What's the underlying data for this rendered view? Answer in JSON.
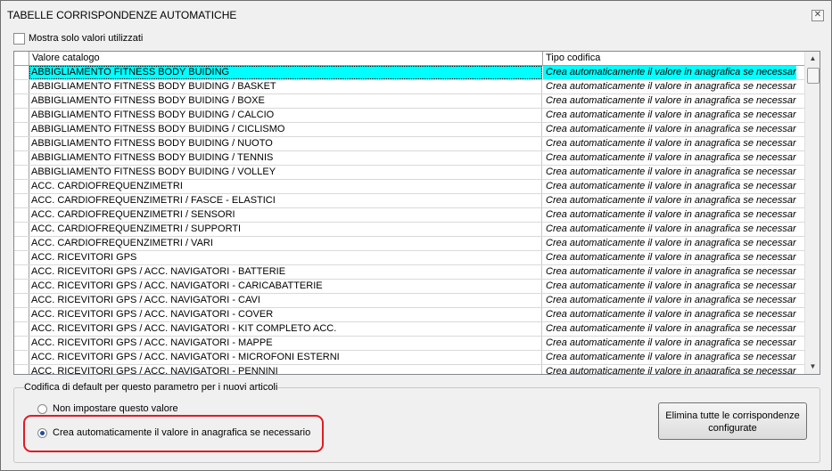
{
  "window": {
    "title": "TABELLE CORRISPONDENZE AUTOMATICHE",
    "close_glyph": "✕"
  },
  "filter": {
    "show_used_only_label": "Mostra solo valori utilizzati",
    "checked": false
  },
  "grid": {
    "columns": [
      "Valore catalogo",
      "Tipo codifica"
    ],
    "rows": [
      {
        "valore": "ABBIGLIAMENTO FITNESS BODY BUIDING",
        "tipo": "Crea automaticamente il valore in anagrafica se necessario"
      },
      {
        "valore": "ABBIGLIAMENTO FITNESS BODY BUIDING / BASKET",
        "tipo": "Crea automaticamente il valore in anagrafica se necessario"
      },
      {
        "valore": "ABBIGLIAMENTO FITNESS BODY BUIDING / BOXE",
        "tipo": "Crea automaticamente il valore in anagrafica se necessario"
      },
      {
        "valore": "ABBIGLIAMENTO FITNESS BODY BUIDING / CALCIO",
        "tipo": "Crea automaticamente il valore in anagrafica se necessario"
      },
      {
        "valore": "ABBIGLIAMENTO FITNESS BODY BUIDING / CICLISMO",
        "tipo": "Crea automaticamente il valore in anagrafica se necessario"
      },
      {
        "valore": "ABBIGLIAMENTO FITNESS BODY BUIDING / NUOTO",
        "tipo": "Crea automaticamente il valore in anagrafica se necessario"
      },
      {
        "valore": "ABBIGLIAMENTO FITNESS BODY BUIDING / TENNIS",
        "tipo": "Crea automaticamente il valore in anagrafica se necessario"
      },
      {
        "valore": "ABBIGLIAMENTO FITNESS BODY BUIDING / VOLLEY",
        "tipo": "Crea automaticamente il valore in anagrafica se necessario"
      },
      {
        "valore": "ACC. CARDIOFREQUENZIMETRI",
        "tipo": "Crea automaticamente il valore in anagrafica se necessario"
      },
      {
        "valore": "ACC. CARDIOFREQUENZIMETRI / FASCE - ELASTICI",
        "tipo": "Crea automaticamente il valore in anagrafica se necessario"
      },
      {
        "valore": "ACC. CARDIOFREQUENZIMETRI / SENSORI",
        "tipo": "Crea automaticamente il valore in anagrafica se necessario"
      },
      {
        "valore": "ACC. CARDIOFREQUENZIMETRI / SUPPORTI",
        "tipo": "Crea automaticamente il valore in anagrafica se necessario"
      },
      {
        "valore": "ACC. CARDIOFREQUENZIMETRI / VARI",
        "tipo": "Crea automaticamente il valore in anagrafica se necessario"
      },
      {
        "valore": "ACC. RICEVITORI GPS",
        "tipo": "Crea automaticamente il valore in anagrafica se necessario"
      },
      {
        "valore": "ACC. RICEVITORI GPS / ACC. NAVIGATORI - BATTERIE",
        "tipo": "Crea automaticamente il valore in anagrafica se necessario"
      },
      {
        "valore": "ACC. RICEVITORI GPS / ACC. NAVIGATORI - CARICABATTERIE",
        "tipo": "Crea automaticamente il valore in anagrafica se necessario"
      },
      {
        "valore": "ACC. RICEVITORI GPS / ACC. NAVIGATORI - CAVI",
        "tipo": "Crea automaticamente il valore in anagrafica se necessario"
      },
      {
        "valore": "ACC. RICEVITORI GPS / ACC. NAVIGATORI - COVER",
        "tipo": "Crea automaticamente il valore in anagrafica se necessario"
      },
      {
        "valore": "ACC. RICEVITORI GPS / ACC. NAVIGATORI - KIT COMPLETO ACC.",
        "tipo": "Crea automaticamente il valore in anagrafica se necessario"
      },
      {
        "valore": "ACC. RICEVITORI GPS / ACC. NAVIGATORI - MAPPE",
        "tipo": "Crea automaticamente il valore in anagrafica se necessario"
      },
      {
        "valore": "ACC. RICEVITORI GPS / ACC. NAVIGATORI - MICROFONI ESTERNI",
        "tipo": "Crea automaticamente il valore in anagrafica se necessario"
      },
      {
        "valore": "ACC. RICEVITORI GPS / ACC. NAVIGATORI - PENNINI",
        "tipo": "Crea automaticamente il valore in anagrafica se necessario"
      }
    ],
    "selected_row": 0,
    "selected_color": "#00ffff",
    "scroll_up_glyph": "▲",
    "scroll_down_glyph": "▼"
  },
  "default_coding": {
    "legend": "Codifica di default per questo parametro per i nuovi articoli",
    "options": [
      "Non impostare questo valore",
      "Crea automaticamente il valore in anagrafica se necessario"
    ],
    "selected_option": 1,
    "highlight_color": "#e11b22"
  },
  "actions": {
    "delete_all_label": "Elimina tutte le corrispondenze configurate"
  }
}
